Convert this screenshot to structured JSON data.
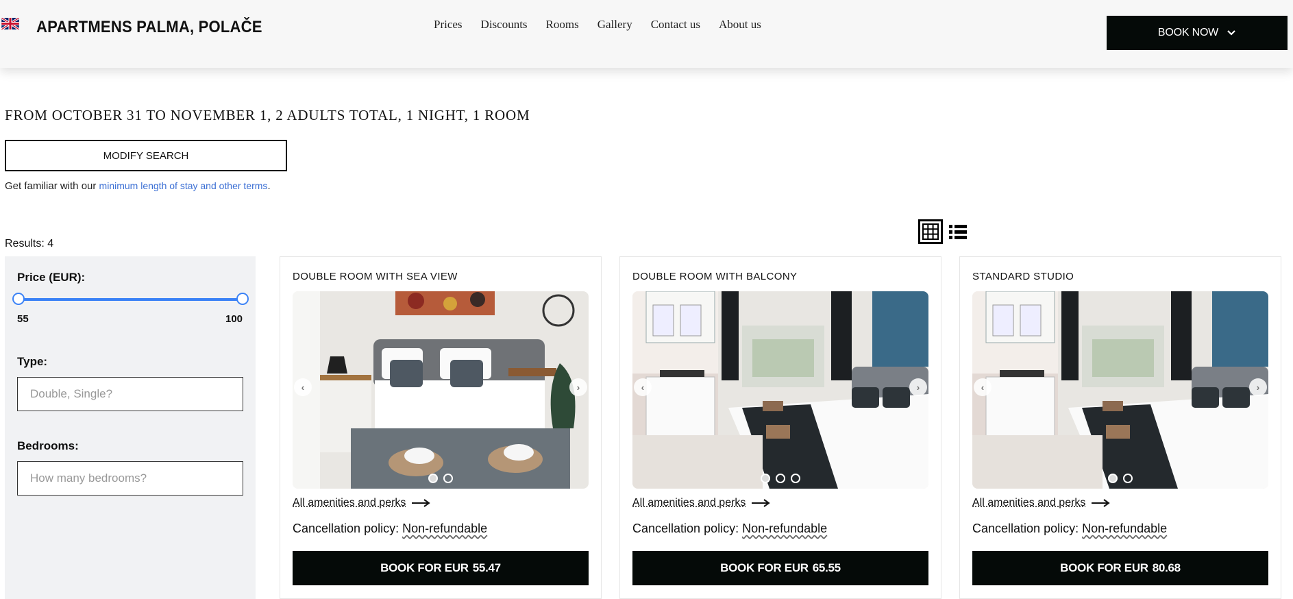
{
  "header": {
    "flag_icon": "uk-flag-icon",
    "title": "APARTMENS PALMA, POLAČE",
    "nav": [
      "Prices",
      "Discounts",
      "Rooms",
      "Gallery",
      "Contact us",
      "About us"
    ],
    "book_now_label": "BOOK NOW"
  },
  "search": {
    "summary": "FROM OCTOBER 31 TO NOVEMBER 1, 2 ADULTS TOTAL, 1 NIGHT, 1 ROOM",
    "modify_label": "MODIFY SEARCH",
    "terms_prefix": "Get familiar with our ",
    "terms_link": "minimum length of stay and other terms",
    "terms_suffix": "."
  },
  "results": {
    "label": "Results: 4"
  },
  "filters": {
    "price_label": "Price (EUR):",
    "price_min": "55",
    "price_max": "100",
    "type_label": "Type:",
    "type_placeholder": "Double, Single?",
    "bedrooms_label": "Bedrooms:",
    "bedrooms_placeholder": "How many bedrooms?"
  },
  "cards": [
    {
      "title": "DOUBLE ROOM WITH SEA VIEW",
      "amenities": "All amenities and perks",
      "cancel_prefix": "Cancellation policy: ",
      "cancel_value": "Non-refundable",
      "book_prefix": "BOOK FOR EUR",
      "price": "55.47",
      "slide_count": 2
    },
    {
      "title": "DOUBLE ROOM WITH BALCONY",
      "amenities": "All amenities and perks",
      "cancel_prefix": "Cancellation policy: ",
      "cancel_value": "Non-refundable",
      "book_prefix": "BOOK FOR EUR",
      "price": "65.55",
      "slide_count": 3
    },
    {
      "title": "STANDARD STUDIO",
      "amenities": "All amenities and perks",
      "cancel_prefix": "Cancellation policy: ",
      "cancel_value": "Non-refundable",
      "book_prefix": "BOOK FOR EUR",
      "price": "80.68",
      "slide_count": 2
    }
  ],
  "colors": {
    "accent": "#3b82f6",
    "button_dark": "#050a08",
    "link": "#3b6fd4"
  }
}
